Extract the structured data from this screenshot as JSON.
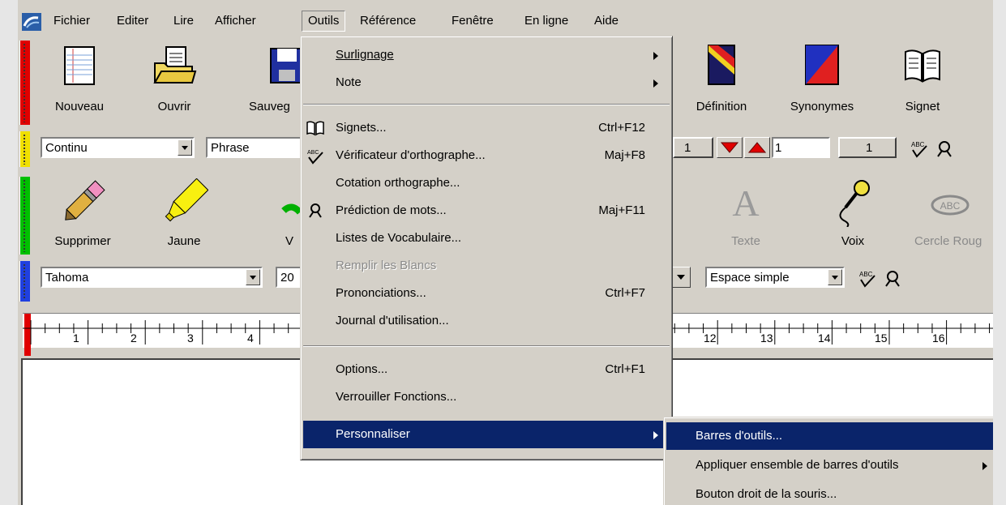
{
  "menubar": [
    "Fichier",
    "Editer",
    "Lire",
    "Afficher",
    "Outils",
    "Référence",
    "Fenêtre",
    "En ligne",
    "Aide"
  ],
  "toolbar1": {
    "nouveau": "Nouveau",
    "ouvrir": "Ouvrir",
    "sauver": "Sauveg",
    "definition": "Définition",
    "synonymes": "Synonymes",
    "signet": "Signet"
  },
  "toolbar2": {
    "mode": "Continu",
    "unit": "Phrase",
    "page_left": "1",
    "page_value": "1",
    "page_count": "1"
  },
  "toolbar3": {
    "supprimer": "Supprimer",
    "jaune": "Jaune",
    "vert": "V",
    "texte": "Texte",
    "voix": "Voix",
    "cercle": "Cercle Roug"
  },
  "toolbar4": {
    "font": "Tahoma",
    "size": "20",
    "spacing": "Espace simple"
  },
  "ruler": {
    "labels": [
      "1",
      "2",
      "3",
      "4",
      "12",
      "13",
      "14",
      "15",
      "16"
    ]
  },
  "outils_menu": {
    "surlignage": "Surlignage",
    "note": "Note",
    "signets": "Signets...",
    "signets_key": "Ctrl+F12",
    "verif": "Vérificateur d'orthographe...",
    "verif_key": "Maj+F8",
    "cotation": "Cotation orthographe...",
    "prediction": "Prédiction de mots...",
    "prediction_key": "Maj+F11",
    "listes": "Listes de Vocabulaire...",
    "remplir": "Remplir les Blancs",
    "prononciations": "Prononciations...",
    "prononciations_key": "Ctrl+F7",
    "journal": "Journal d'utilisation...",
    "options": "Options...",
    "options_key": "Ctrl+F1",
    "verrouiller": "Verrouiller Fonctions...",
    "personnaliser": "Personnaliser"
  },
  "personnaliser_menu": {
    "barres": "Barres d'outils...",
    "appliquer": "Appliquer ensemble de barres d'outils",
    "bouton": "Bouton droit de la souris..."
  },
  "colors": {
    "highlight": "#0a246a",
    "face": "#d4d0c8"
  }
}
